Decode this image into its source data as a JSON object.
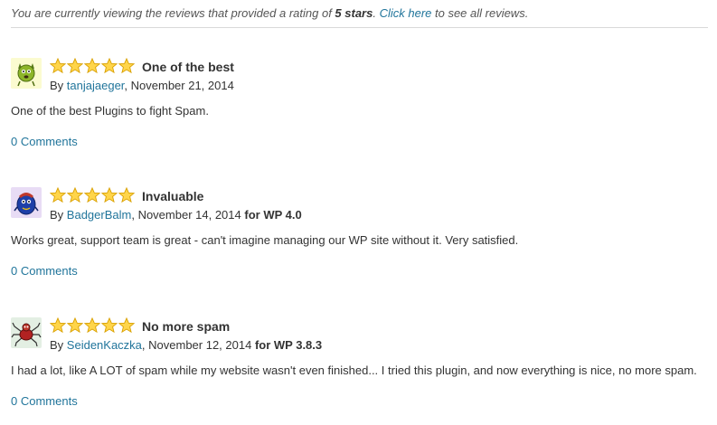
{
  "notice": {
    "prefix": "You are currently viewing the reviews that provided a rating of ",
    "rating": "5 stars",
    "middle": ". ",
    "link": "Click here",
    "suffix": " to see all reviews."
  },
  "colors": {
    "link": "#21759b",
    "star_fill": "#ffd54a",
    "star_stroke": "#d9a000",
    "divider": "#d9d9d9"
  },
  "reviews": [
    {
      "title": "One of the best",
      "by": "By ",
      "author": "tanjajaeger",
      "date": ", November 21, 2014",
      "version_prefix": "",
      "body": "One of the best Plugins to fight Spam.",
      "comments": "0 Comments",
      "rating": 5,
      "avatar_icon": "green-monster-avatar-icon"
    },
    {
      "title": "Invaluable",
      "by": "By ",
      "author": "BadgerBalm",
      "date": ", November 14, 2014 ",
      "version_prefix": "for WP 4.0",
      "body": "Works great, support team is great - can't imagine managing our WP site without it. Very satisfied.",
      "comments": "0 Comments",
      "rating": 5,
      "avatar_icon": "blue-monster-avatar-icon"
    },
    {
      "title": "No more spam",
      "by": "By ",
      "author": "SeidenKaczka",
      "date": ", November 12, 2014 ",
      "version_prefix": "for WP 3.8.3",
      "body": "I had a lot, like A LOT of spam while my website wasn't even finished... I tried this plugin, and now everything is nice, no more spam.",
      "comments": "0 Comments",
      "rating": 5,
      "avatar_icon": "red-spider-avatar-icon"
    }
  ]
}
